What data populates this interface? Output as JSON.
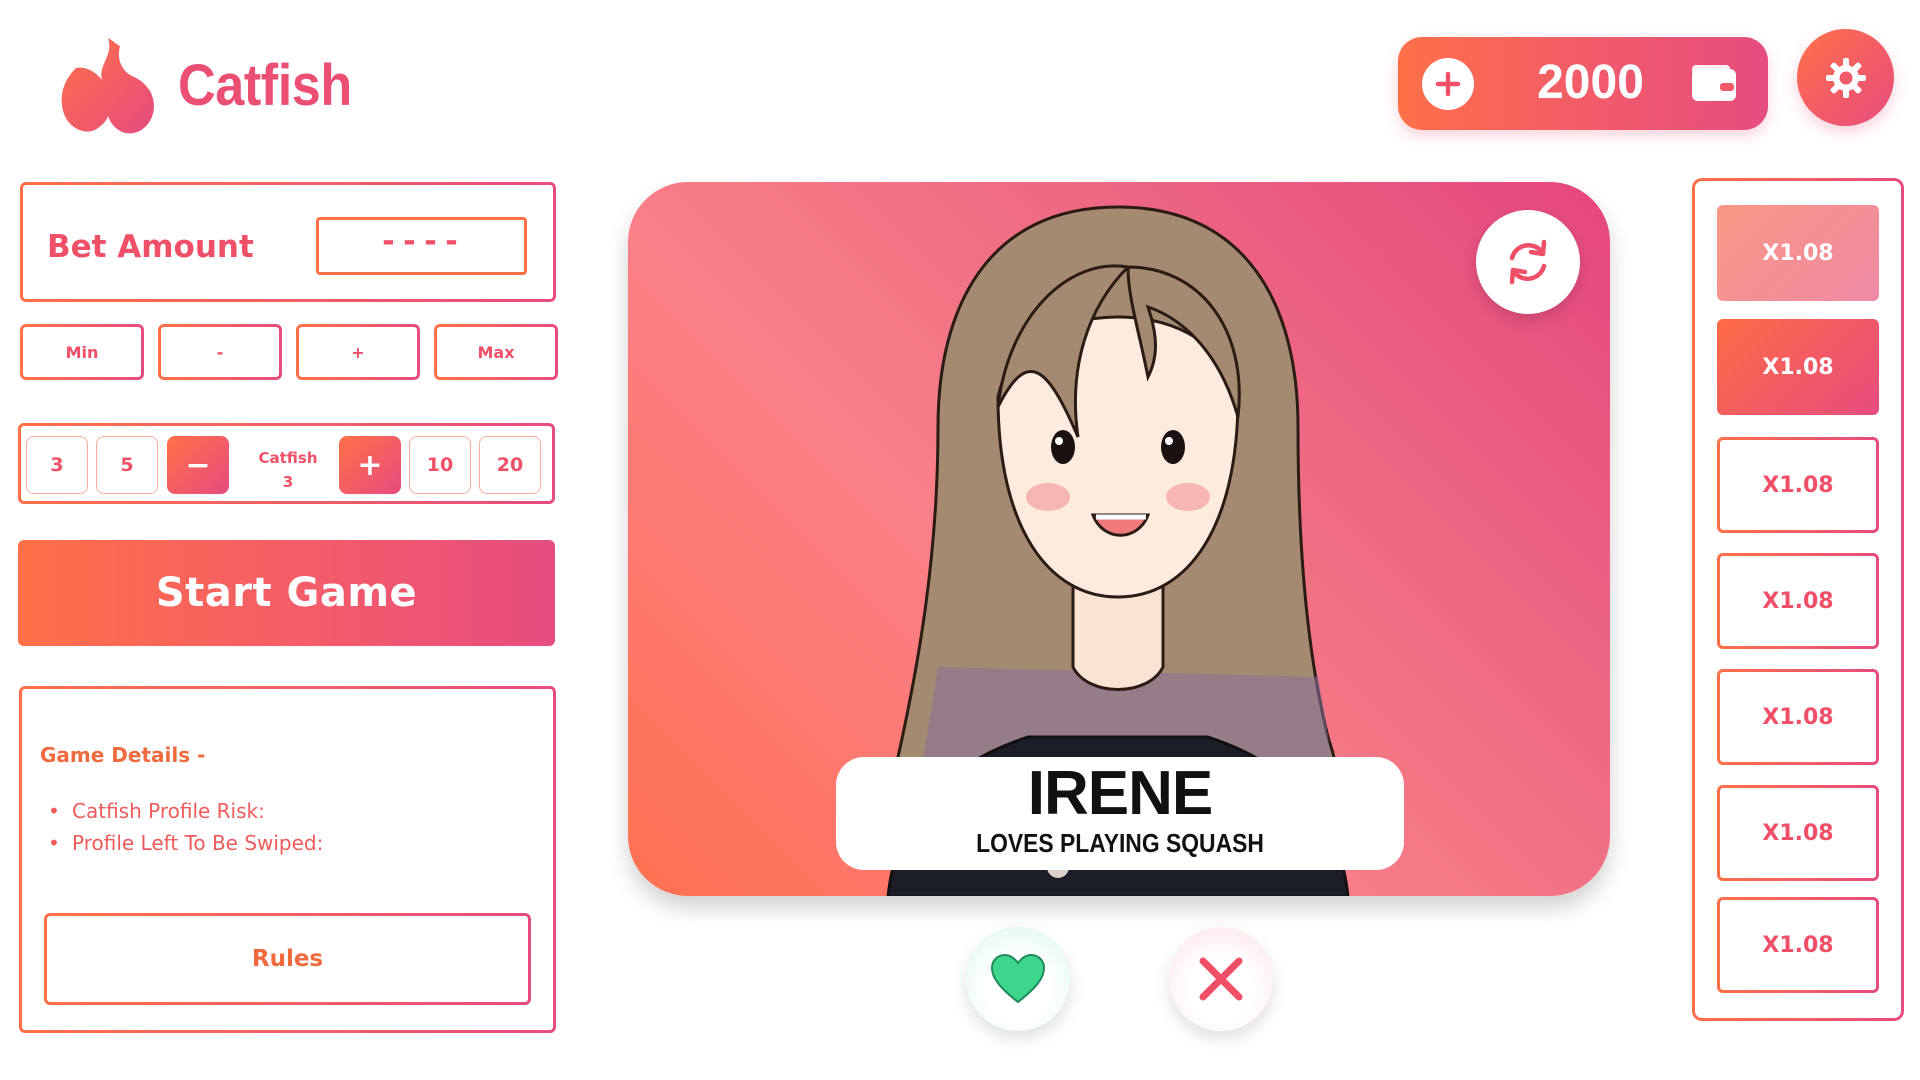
{
  "brand": {
    "name": "Catfish"
  },
  "wallet": {
    "amount": "2000"
  },
  "bet": {
    "label": "Bet Amount",
    "value": "----",
    "buttons": {
      "min": "Min",
      "minus": "-",
      "plus": "+",
      "max": "Max"
    }
  },
  "catfish_picker": {
    "options_left": [
      "3",
      "5"
    ],
    "decrement": "−",
    "label": "Catfish",
    "count": "3",
    "increment": "+",
    "options_right": [
      "10",
      "20"
    ]
  },
  "start_button": "Start Game",
  "details": {
    "title": "Game Details -",
    "items": [
      "Catfish Profile Risk:",
      "Profile Left To Be Swiped:"
    ],
    "rules_button": "Rules"
  },
  "profile": {
    "name": "IRENE",
    "tagline": "LOVES PLAYING SQUASH"
  },
  "multipliers": [
    "X1.08",
    "X1.08",
    "X1.08",
    "X1.08",
    "X1.08",
    "X1.08",
    "X1.08"
  ],
  "colors": {
    "accent_orange": "#ff7048",
    "accent_pink": "#e64c7f",
    "like_green": "#3dd68c",
    "nope_red": "#ef5067"
  },
  "icons": {
    "logo": "flame-heart-icon",
    "wallet_add": "plus-circle-icon",
    "wallet": "wallet-icon",
    "settings": "gear-icon",
    "refresh": "refresh-icon",
    "like": "heart-icon",
    "nope": "close-icon"
  }
}
